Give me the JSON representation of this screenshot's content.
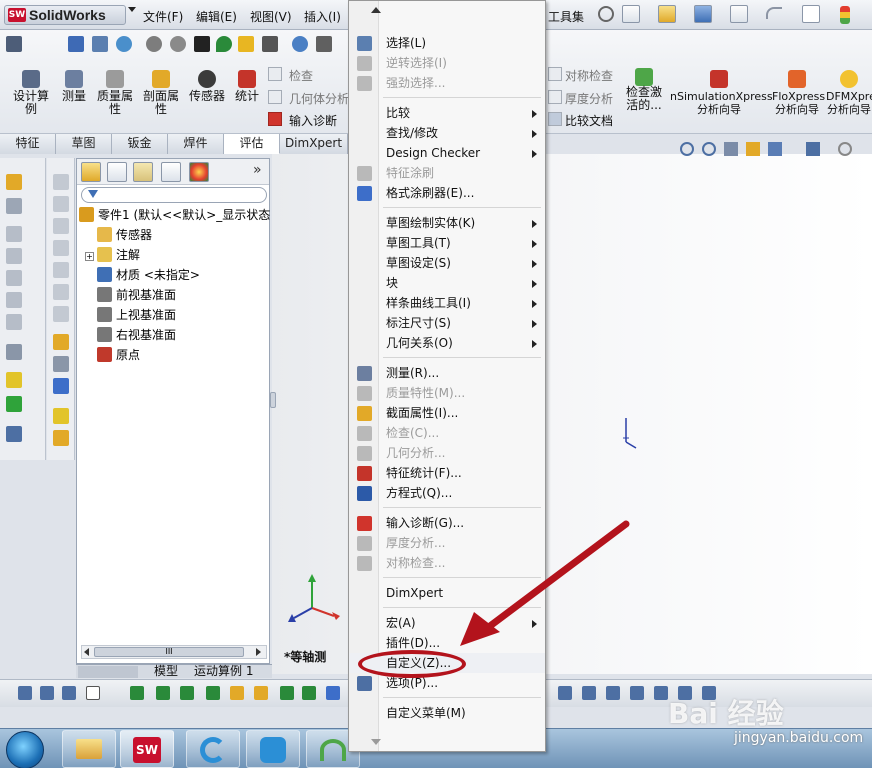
{
  "app": {
    "logo_text": "SolidWorks",
    "logo_mark": "SW"
  },
  "menubar": {
    "items": [
      "文件(F)",
      "编辑(E)",
      "视图(V)",
      "插入(I)"
    ],
    "right_fragment": "工具集"
  },
  "command_manager": {
    "buttons": [
      {
        "label": "设计算例",
        "icon": "design-study-icon"
      },
      {
        "label": "测量",
        "icon": "measure-icon"
      },
      {
        "label": "质量属性",
        "icon": "mass-properties-icon"
      },
      {
        "label": "剖面属性",
        "icon": "section-properties-icon"
      },
      {
        "label": "传感器",
        "icon": "sensor-icon"
      },
      {
        "label": "统计",
        "icon": "statistics-icon"
      }
    ],
    "checks": [
      {
        "label": "检查"
      },
      {
        "label": "几何体分析"
      },
      {
        "label": "输入诊断"
      }
    ],
    "right_checks": [
      {
        "label": "对称检查"
      },
      {
        "label": "厚度分析"
      },
      {
        "label": "比较文档"
      }
    ],
    "right_buttons": [
      {
        "label": "检查激活的...",
        "icon": "check-active-icon"
      },
      {
        "label": "nSimulationXpress分析向导",
        "icon": "simulationxpress-icon"
      },
      {
        "label": "FloXpress分析向导",
        "icon": "floxpress-icon"
      },
      {
        "label": "DFMXpress分析向导",
        "icon": "dfmxpress-icon"
      }
    ]
  },
  "tabs": [
    {
      "label": "特征",
      "active": false
    },
    {
      "label": "草图",
      "active": false
    },
    {
      "label": "钣金",
      "active": false
    },
    {
      "label": "焊件",
      "active": false
    },
    {
      "label": "评估",
      "active": true
    },
    {
      "label": "DimXpert",
      "active": false
    }
  ],
  "feature_tree": {
    "collapse_label": "»",
    "items": [
      {
        "label": "零件1 (默认<<默认>_显示状态",
        "icon": "part-icon",
        "color": "#d99b1e"
      },
      {
        "label": "传感器",
        "icon": "sensor-folder-icon",
        "color": "#e6b84a"
      },
      {
        "label": "注解",
        "icon": "annotations-icon",
        "color": "#e6c14e"
      },
      {
        "label": "材质 <未指定>",
        "icon": "material-icon",
        "color": "#3f6fb5"
      },
      {
        "label": "前视基准面",
        "icon": "plane-icon",
        "color": "#777"
      },
      {
        "label": "上视基准面",
        "icon": "plane-icon",
        "color": "#777"
      },
      {
        "label": "右视基准面",
        "icon": "plane-icon",
        "color": "#777"
      },
      {
        "label": "原点",
        "icon": "origin-icon",
        "color": "#c0392b"
      }
    ],
    "hscroll_grip": "III"
  },
  "bottom_tabs": [
    "模型",
    "运动算例 1"
  ],
  "view_label": "*等轴测",
  "context_menu": {
    "items": [
      {
        "type": "item",
        "label": "选择(L)",
        "disabled": false,
        "arrow": false,
        "icon": "select-arrow-icon",
        "color": "#5b7fb0"
      },
      {
        "type": "item",
        "label": "逆转选择(I)",
        "disabled": true,
        "arrow": false,
        "icon": "invert-select-icon",
        "color": "#b9b9b9"
      },
      {
        "type": "item",
        "label": "强劲选择...",
        "disabled": true,
        "arrow": false,
        "icon": "power-select-icon",
        "color": "#b9b9b9"
      },
      {
        "type": "sep"
      },
      {
        "type": "item",
        "label": "比较",
        "disabled": false,
        "arrow": true,
        "icon": "",
        "color": ""
      },
      {
        "type": "item",
        "label": "查找/修改",
        "disabled": false,
        "arrow": true,
        "icon": "",
        "color": ""
      },
      {
        "type": "item",
        "label": "Design Checker",
        "disabled": false,
        "arrow": true,
        "icon": "",
        "color": ""
      },
      {
        "type": "item",
        "label": "特征涂刷",
        "disabled": true,
        "arrow": false,
        "icon": "feature-paint-icon",
        "color": "#b9b9b9"
      },
      {
        "type": "item",
        "label": "格式涂刷器(E)...",
        "disabled": false,
        "arrow": false,
        "icon": "format-painter-icon",
        "color": "#3d6ec9"
      },
      {
        "type": "sep"
      },
      {
        "type": "item",
        "label": "草图绘制实体(K)",
        "disabled": false,
        "arrow": true,
        "icon": "",
        "color": ""
      },
      {
        "type": "item",
        "label": "草图工具(T)",
        "disabled": false,
        "arrow": true,
        "icon": "",
        "color": ""
      },
      {
        "type": "item",
        "label": "草图设定(S)",
        "disabled": false,
        "arrow": true,
        "icon": "",
        "color": ""
      },
      {
        "type": "item",
        "label": "块",
        "disabled": false,
        "arrow": true,
        "icon": "",
        "color": ""
      },
      {
        "type": "item",
        "label": "样条曲线工具(I)",
        "disabled": false,
        "arrow": true,
        "icon": "",
        "color": ""
      },
      {
        "type": "item",
        "label": "标注尺寸(S)",
        "disabled": false,
        "arrow": true,
        "icon": "",
        "color": ""
      },
      {
        "type": "item",
        "label": "几何关系(O)",
        "disabled": false,
        "arrow": true,
        "icon": "",
        "color": ""
      },
      {
        "type": "sep"
      },
      {
        "type": "item",
        "label": "测量(R)...",
        "disabled": false,
        "arrow": false,
        "icon": "measure-icon",
        "color": "#6c7fa0"
      },
      {
        "type": "item",
        "label": "质量特性(M)...",
        "disabled": true,
        "arrow": false,
        "icon": "mass-properties-icon",
        "color": "#b9b9b9"
      },
      {
        "type": "item",
        "label": "截面属性(I)...",
        "disabled": false,
        "arrow": false,
        "icon": "section-properties-icon",
        "color": "#e2a928"
      },
      {
        "type": "item",
        "label": "检查(C)...",
        "disabled": true,
        "arrow": false,
        "icon": "check-icon",
        "color": "#b9b9b9"
      },
      {
        "type": "item",
        "label": "几何分析...",
        "disabled": true,
        "arrow": false,
        "icon": "geometry-analysis-icon",
        "color": "#b9b9b9"
      },
      {
        "type": "item",
        "label": "特征统计(F)...",
        "disabled": false,
        "arrow": false,
        "icon": "feature-statistics-icon",
        "color": "#c4342a"
      },
      {
        "type": "item",
        "label": "方程式(Q)...",
        "disabled": false,
        "arrow": false,
        "icon": "equation-sigma-icon",
        "color": "#2c5aa8"
      },
      {
        "type": "sep"
      },
      {
        "type": "item",
        "label": "输入诊断(G)...",
        "disabled": false,
        "arrow": false,
        "icon": "import-diagnostics-icon",
        "color": "#d0342c"
      },
      {
        "type": "item",
        "label": "厚度分析...",
        "disabled": true,
        "arrow": false,
        "icon": "thickness-analysis-icon",
        "color": "#b9b9b9"
      },
      {
        "type": "item",
        "label": "对称检查...",
        "disabled": true,
        "arrow": false,
        "icon": "symmetry-check-icon",
        "color": "#b9b9b9"
      },
      {
        "type": "sep"
      },
      {
        "type": "item",
        "label": "DimXpert",
        "disabled": false,
        "arrow": false,
        "icon": "",
        "color": ""
      },
      {
        "type": "sep"
      },
      {
        "type": "item",
        "label": "宏(A)",
        "disabled": false,
        "arrow": true,
        "icon": "",
        "color": ""
      },
      {
        "type": "item",
        "label": "插件(D)...",
        "disabled": false,
        "arrow": false,
        "icon": "",
        "color": ""
      },
      {
        "type": "item",
        "label": "自定义(Z)...",
        "disabled": false,
        "arrow": false,
        "icon": "",
        "color": "",
        "highlighted": true
      },
      {
        "type": "item",
        "label": "选项(P)...",
        "disabled": false,
        "arrow": false,
        "icon": "options-icon",
        "color": "#4d6fa3"
      },
      {
        "type": "sep"
      },
      {
        "type": "item",
        "label": "自定义菜单(M)",
        "disabled": false,
        "arrow": false,
        "icon": "",
        "color": ""
      }
    ]
  },
  "watermark": {
    "brand": "Bai 经验",
    "url": "jingyan.baidu.com"
  },
  "colors": {
    "accent_red": "#b3131c",
    "solidworks_red": "#c8102e"
  }
}
